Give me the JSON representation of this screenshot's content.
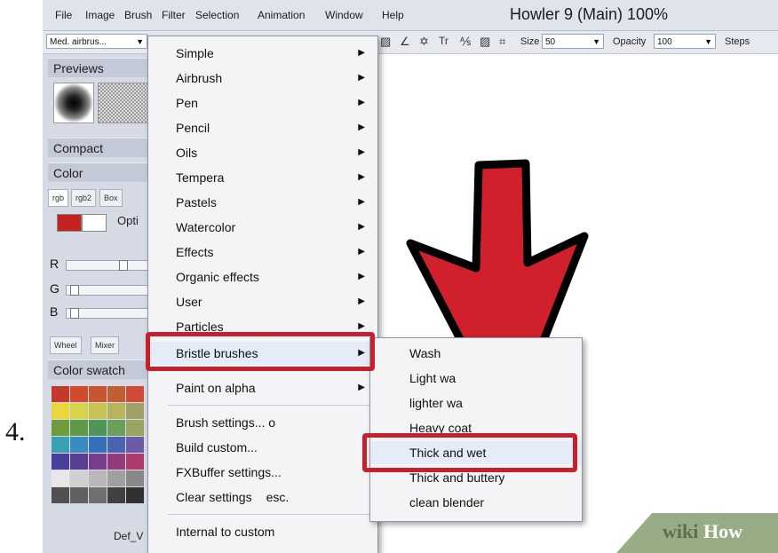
{
  "step_number": "4.",
  "menubar": {
    "items": [
      "File",
      "Image",
      "Brush",
      "Filter",
      "Selection",
      "Animation",
      "Window",
      "Help"
    ],
    "title": "Howler 9  (Main)  100%"
  },
  "toolbar": {
    "brush_preset": "Med. airbrus...",
    "size_label": "Size",
    "size_value": "50",
    "opacity_label": "Opacity",
    "opacity_value": "100",
    "steps_label": "Steps",
    "icons": [
      "pen-tool-icon",
      "settings-icon",
      "text-icon",
      "path-icon",
      "frame-icon",
      "crosshair-icon"
    ]
  },
  "left_panel": {
    "previews": "Previews",
    "compact": "Compact",
    "color": "Color",
    "tabs": [
      "rgb",
      "rgb2",
      "Box"
    ],
    "options_partial": "Opti",
    "channels": [
      "R",
      "G",
      "B"
    ],
    "channel_levels": [
      0.7,
      0.05,
      0.05
    ],
    "lower_tabs": [
      "Wheel",
      "Mixer"
    ],
    "swatches_title": "Color swatch",
    "palette_name": "Def_V",
    "primary_color": "#c42121",
    "swatch_colors": [
      "#c43a2a",
      "#d2492e",
      "#c8552f",
      "#c25f32",
      "#d04a38",
      "#e8d83e",
      "#d8d44a",
      "#c7c255",
      "#b6b45d",
      "#a0a068",
      "#6e9c3a",
      "#5f9a46",
      "#4f9656",
      "#6aa05c",
      "#9aa45e",
      "#3aa0b2",
      "#3a8cc0",
      "#3670bd",
      "#4a62b2",
      "#6a5aa8",
      "#4a3e9c",
      "#5a3e96",
      "#7a3c8e",
      "#963a7e",
      "#b03a6e",
      "#e8e8e8",
      "#d0d0d0",
      "#b8b8b8",
      "#a0a0a0",
      "#888888",
      "#505050",
      "#606060",
      "#707070",
      "#404040",
      "#303030"
    ]
  },
  "brush_menu": {
    "items": [
      "Simple",
      "Airbrush",
      "Pen",
      "Pencil",
      "Oils",
      "Tempera",
      "Pastels",
      "Watercolor",
      "Effects",
      "Organic effects",
      "User",
      "Particles",
      "Bristle brushes"
    ],
    "paint_on_alpha": "Paint on alpha",
    "brush_settings": "Brush settings...",
    "brush_settings_key": "o",
    "build_custom": "Build custom...",
    "fxbuffer": "FXBuffer settings...",
    "clear_settings": "Clear settings",
    "clear_key": "esc.",
    "internal_to_custom": "Internal to custom"
  },
  "submenu": {
    "items": [
      "Wash",
      "Light wa",
      "lighter wa",
      "Heavy coat",
      "Thick and wet",
      "Thick and buttery",
      "clean blender"
    ]
  },
  "annotation": {
    "arrow_color": "#d0202c",
    "highlight_color": "#c4212c"
  },
  "watermark": {
    "wiki": "wiki",
    "how": "How"
  }
}
